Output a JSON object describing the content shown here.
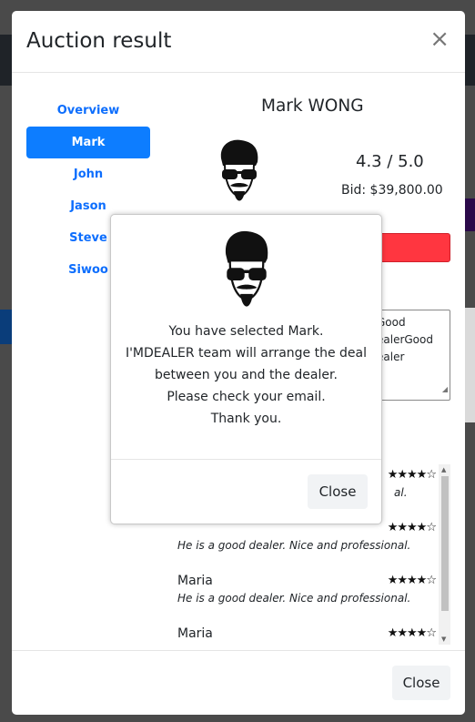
{
  "modal": {
    "title": "Auction result",
    "close_symbol": "×",
    "footer_close_label": "Close"
  },
  "sidebar": {
    "items": [
      {
        "label": "Overview",
        "active": false
      },
      {
        "label": "Mark",
        "active": true
      },
      {
        "label": "John",
        "active": false
      },
      {
        "label": "Jason",
        "active": false
      },
      {
        "label": "Steve",
        "active": false
      },
      {
        "label": "Siwoo",
        "active": false
      }
    ]
  },
  "dealer": {
    "name": "Mark WONG",
    "score": "4.3 / 5.0",
    "bid": "Bid: $39,800.00",
    "description_visible": "Good\nealerGood\nealer"
  },
  "reviews": [
    {
      "user": "",
      "stars": "★★★★☆",
      "text": "al."
    },
    {
      "user": "",
      "stars": "★★★★☆",
      "text": "He is a good dealer. Nice and professional."
    },
    {
      "user": "Maria",
      "stars": "★★★★☆",
      "text": "He is a good dealer. Nice and professional."
    },
    {
      "user": "Maria",
      "stars": "★★★★☆",
      "text": ""
    }
  ],
  "dialog": {
    "lines": [
      "You have selected Mark.",
      "I'MDEALER team will arrange the deal",
      "between you and the dealer.",
      "Please check your email.",
      "Thank you."
    ],
    "close_label": "Close"
  },
  "colors": {
    "accent": "#0d7dff",
    "danger": "#ff3640"
  },
  "icons": [
    "close-icon",
    "dealer-avatar-icon",
    "scroll-up-icon",
    "scroll-down-icon",
    "resize-grip-icon"
  ]
}
